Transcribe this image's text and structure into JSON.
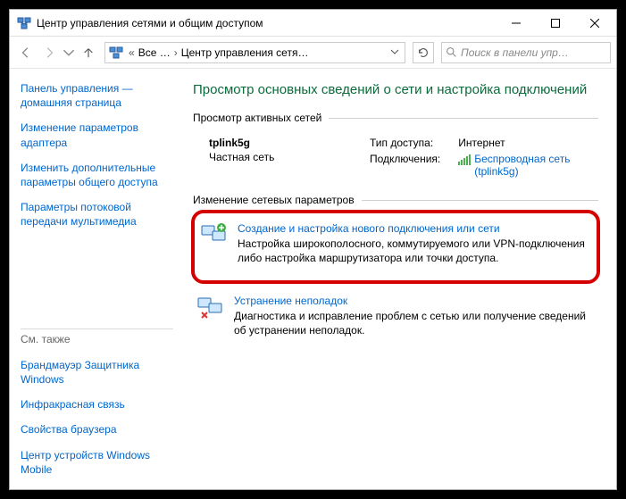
{
  "window": {
    "title": "Центр управления сетями и общим доступом"
  },
  "breadcrumb": {
    "root": "Все …",
    "current": "Центр управления сетя…"
  },
  "search": {
    "placeholder": "Поиск в панели упр…"
  },
  "sidebar": {
    "home": "Панель управления — домашняя страница",
    "links": [
      "Изменение параметров адаптера",
      "Изменить дополнительные параметры общего доступа",
      "Параметры потоковой передачи мультимедиа"
    ],
    "see_also_label": "См. также",
    "see_also": [
      "Брандмауэр Защитника Windows",
      "Инфракрасная связь",
      "Свойства браузера",
      "Центр устройств Windows Mobile"
    ]
  },
  "main": {
    "heading": "Просмотр основных сведений о сети и настройка подключений",
    "active_label": "Просмотр активных сетей",
    "network": {
      "name": "tplink5g",
      "type": "Частная сеть",
      "access_label": "Тип доступа:",
      "access_value": "Интернет",
      "conn_label": "Подключения:",
      "conn_value": "Беспроводная сеть (tplink5g)"
    },
    "change_label": "Изменение сетевых параметров",
    "tasks": [
      {
        "title": "Создание и настройка нового подключения или сети",
        "desc": "Настройка широкополосного, коммутируемого или VPN-подключения либо настройка маршрутизатора или точки доступа."
      },
      {
        "title": "Устранение неполадок",
        "desc": "Диагностика и исправление проблем с сетью или получение сведений об устранении неполадок."
      }
    ]
  }
}
